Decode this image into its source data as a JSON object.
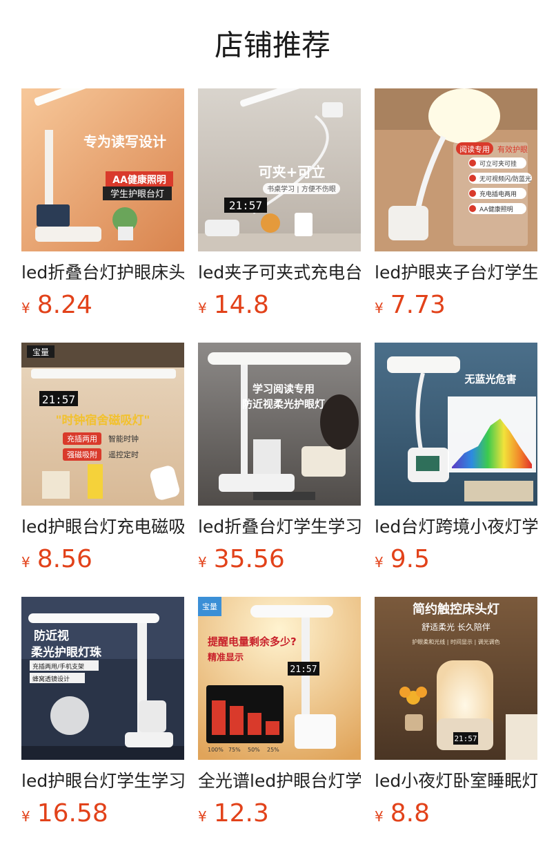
{
  "page": {
    "title": "店铺推荐",
    "currency_symbol": "¥",
    "price_color": "#e2421a"
  },
  "products": [
    {
      "name": "led折叠台灯护眼床头",
      "price": "8.24",
      "image_text": [
        "专为读写设计",
        "AA健康照明",
        "学生护眼台灯"
      ]
    },
    {
      "name": "led夹子可夹式充电台",
      "price": "14.8",
      "image_text": [
        "可夹+可立",
        "书桌学习 | 方便不伤眼",
        "21:57"
      ]
    },
    {
      "name": "led护眼夹子台灯学生",
      "price": "7.73",
      "image_text": [
        "阅读专用",
        "有效护眼",
        "可立可夹可挂",
        "无可视频闪/防蓝光",
        "充电插电两用",
        "AA健康照明"
      ]
    },
    {
      "name": "led护眼台灯充电磁吸",
      "price": "8.56",
      "image_text": [
        "宝量",
        "21:57",
        "\"时钟宿舍磁吸灯\"",
        "充插两用",
        "智能时钟",
        "强磁吸附",
        "遥控定时"
      ]
    },
    {
      "name": "led折叠台灯学生学习",
      "price": "35.56",
      "image_text": [
        "学习阅读专用",
        "防近视柔光护眼灯"
      ]
    },
    {
      "name": "led台灯跨境小夜灯学",
      "price": "9.5",
      "image_text": [
        "无蓝光危害"
      ]
    },
    {
      "name": "led护眼台灯学生学习",
      "price": "16.58",
      "image_text": [
        "防近视",
        "柔光护眼灯珠",
        "充插两用/手机支架",
        "蜂窝透镜设计"
      ]
    },
    {
      "name": "全光谱led护眼台灯学",
      "price": "12.3",
      "image_text": [
        "宝量",
        "提醒电量剩余多少?",
        "精准显示",
        "21:57",
        "100%",
        "75%",
        "50%",
        "25%"
      ]
    },
    {
      "name": "led小夜灯卧室睡眠灯",
      "price": "8.8",
      "image_text": [
        "简约触控床头灯",
        "舒适柔光 长久陪伴",
        "护眼柔和光线 | 时间显示 | 调光调色",
        "21:57"
      ]
    }
  ]
}
